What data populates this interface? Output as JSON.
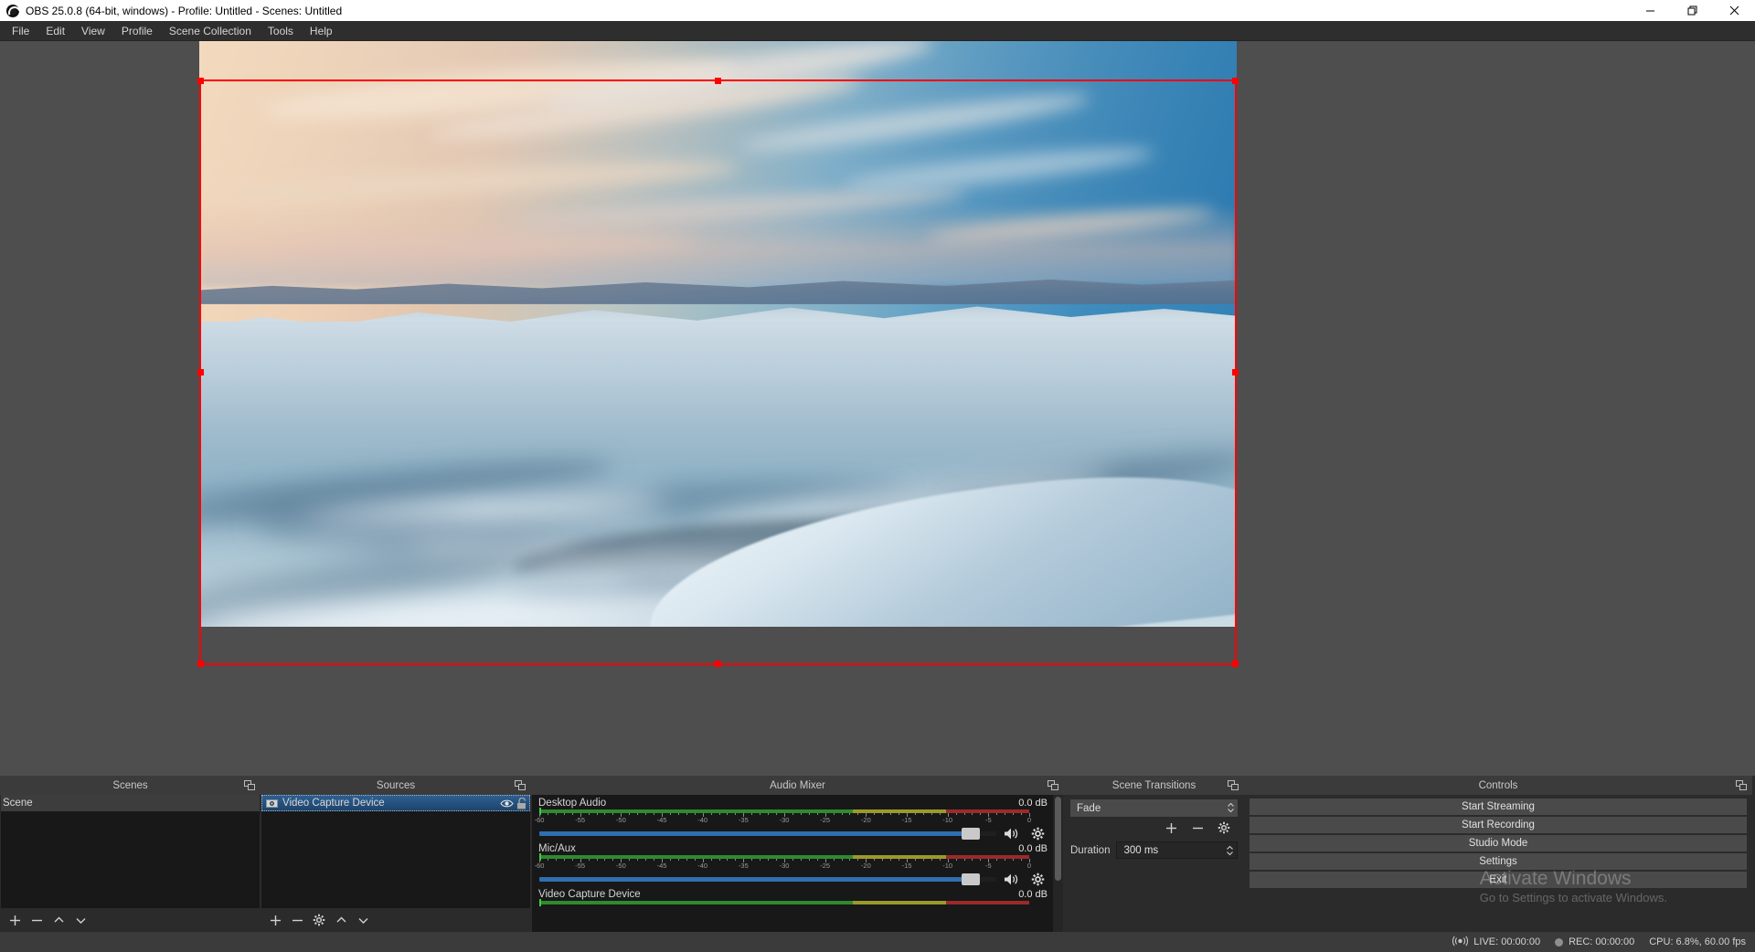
{
  "window": {
    "title": "OBS 25.0.8 (64-bit, windows) - Profile: Untitled - Scenes: Untitled",
    "logo_icon": "obs-logo-icon",
    "minimize_icon": "minimize-icon",
    "restore_icon": "restore-icon",
    "close_icon": "close-icon"
  },
  "menubar": {
    "items": [
      {
        "label": "File"
      },
      {
        "label": "Edit"
      },
      {
        "label": "View"
      },
      {
        "label": "Profile"
      },
      {
        "label": "Scene Collection"
      },
      {
        "label": "Tools"
      },
      {
        "label": "Help"
      }
    ]
  },
  "preview": {
    "name": "program-preview",
    "selection_color": "#ff0000",
    "scene_description": "Aerial view of snow-covered mountain range at sunset with orange and blue sky"
  },
  "scenes_dock": {
    "title": "Scenes",
    "float_icon": "undock-icon",
    "items": [
      {
        "label": "Scene",
        "selected": true
      }
    ],
    "toolbar": [
      {
        "name": "add-scene-button",
        "icon": "plus-icon"
      },
      {
        "name": "remove-scene-button",
        "icon": "minus-icon"
      },
      {
        "name": "move-scene-up-button",
        "icon": "chevron-up-icon"
      },
      {
        "name": "move-scene-down-button",
        "icon": "chevron-down-icon"
      }
    ]
  },
  "sources_dock": {
    "title": "Sources",
    "float_icon": "undock-icon",
    "items": [
      {
        "label": "Video Capture Device",
        "selected": true,
        "icon": "camera-icon",
        "visibility_icon": "eye-icon",
        "lock_icon": "unlock-icon"
      }
    ],
    "toolbar": [
      {
        "name": "add-source-button",
        "icon": "plus-icon"
      },
      {
        "name": "remove-source-button",
        "icon": "minus-icon"
      },
      {
        "name": "source-properties-button",
        "icon": "gear-icon"
      },
      {
        "name": "move-source-up-button",
        "icon": "chevron-up-icon"
      },
      {
        "name": "move-source-down-button",
        "icon": "chevron-down-icon"
      }
    ]
  },
  "audio_mixer": {
    "title": "Audio Mixer",
    "float_icon": "undock-icon",
    "tick_labels": [
      "-60",
      "-55",
      "-50",
      "-45",
      "-40",
      "-35",
      "-30",
      "-25",
      "-20",
      "-15",
      "-10",
      "-5",
      "0"
    ],
    "channels": [
      {
        "name": "Desktop Audio",
        "db": "0.0 dB",
        "volume_percent": 96,
        "speaker_icon": "speaker-icon",
        "gear_icon": "gear-icon"
      },
      {
        "name": "Mic/Aux",
        "db": "0.0 dB",
        "volume_percent": 96,
        "speaker_icon": "speaker-icon",
        "gear_icon": "gear-icon"
      },
      {
        "name": "Video Capture Device",
        "db": "0.0 dB",
        "volume_percent": 96,
        "speaker_icon": "speaker-icon",
        "gear_icon": "gear-icon"
      }
    ]
  },
  "scene_transitions": {
    "title": "Scene Transitions",
    "float_icon": "undock-icon",
    "selected_transition": "Fade",
    "add_icon": "plus-icon",
    "remove_icon": "minus-icon",
    "config_icon": "gear-icon",
    "duration_label": "Duration",
    "duration_value": "300 ms"
  },
  "controls": {
    "title": "Controls",
    "float_icon": "undock-icon",
    "buttons": [
      {
        "label": "Start Streaming",
        "name": "start-streaming-button"
      },
      {
        "label": "Start Recording",
        "name": "start-recording-button"
      },
      {
        "label": "Studio Mode",
        "name": "studio-mode-button"
      },
      {
        "label": "Settings",
        "name": "settings-button"
      },
      {
        "label": "Exit",
        "name": "exit-button"
      }
    ]
  },
  "watermark": {
    "title": "Activate Windows",
    "subtitle": "Go to Settings to activate Windows."
  },
  "statusbar": {
    "broadcast_icon": "broadcast-icon",
    "live": "LIVE: 00:00:00",
    "rec_icon": "record-dot-icon",
    "rec": "REC: 00:00:00",
    "cpu": "CPU: 6.8%, 60.00 fps"
  }
}
